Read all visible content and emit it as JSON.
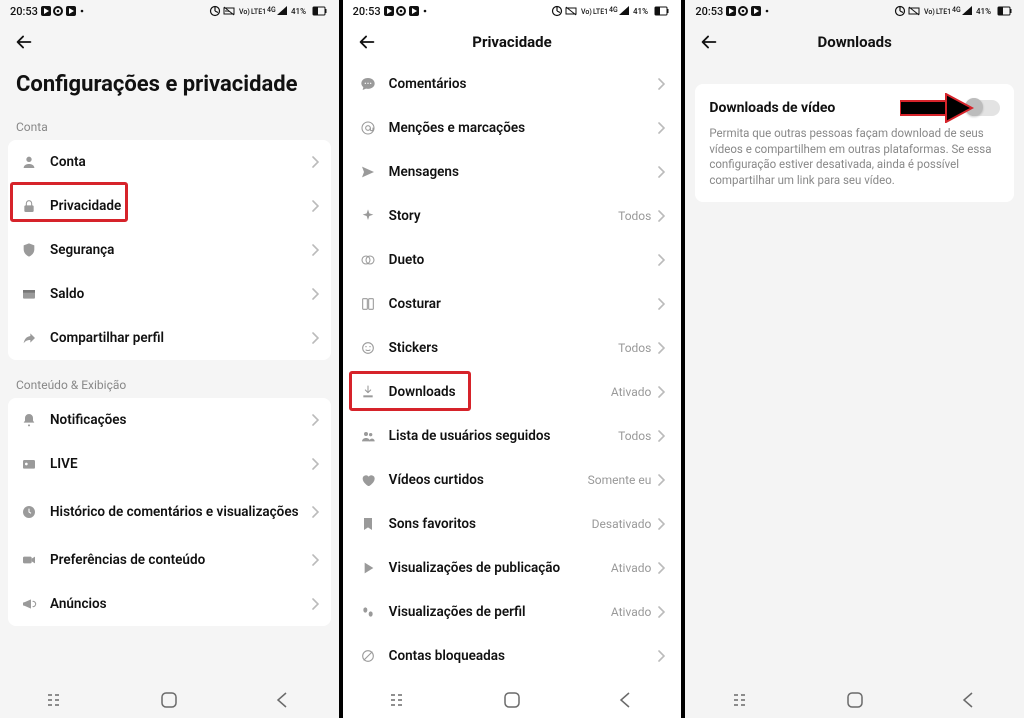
{
  "status": {
    "time": "20:53",
    "battery_text": "41%",
    "net_label": "4G"
  },
  "screen1": {
    "title": "Configurações e privacidade",
    "section_conta": "Conta",
    "section_conteudo": "Conteúdo & Exibição",
    "items_conta": [
      {
        "icon": "person",
        "label": "Conta"
      },
      {
        "icon": "lock",
        "label": "Privacidade",
        "highlight": true
      },
      {
        "icon": "shield",
        "label": "Segurança"
      },
      {
        "icon": "wallet",
        "label": "Saldo"
      },
      {
        "icon": "share",
        "label": "Compartilhar perfil"
      }
    ],
    "items_conteudo": [
      {
        "icon": "bell",
        "label": "Notificações"
      },
      {
        "icon": "live",
        "label": "LIVE"
      },
      {
        "icon": "clock",
        "label": "Histórico de comentários e visualizações"
      },
      {
        "icon": "video",
        "label": "Preferências de conteúdo"
      },
      {
        "icon": "megaphone",
        "label": "Anúncios"
      }
    ]
  },
  "screen2": {
    "title": "Privacidade",
    "items": [
      {
        "icon": "comment",
        "label": "Comentários",
        "value": ""
      },
      {
        "icon": "at",
        "label": "Menções e marcações",
        "value": ""
      },
      {
        "icon": "send",
        "label": "Mensagens",
        "value": ""
      },
      {
        "icon": "sparkle",
        "label": "Story",
        "value": "Todos"
      },
      {
        "icon": "duet",
        "label": "Dueto",
        "value": ""
      },
      {
        "icon": "stitch",
        "label": "Costurar",
        "value": ""
      },
      {
        "icon": "sticker",
        "label": "Stickers",
        "value": "Todos"
      },
      {
        "icon": "download",
        "label": "Downloads",
        "value": "Ativado",
        "highlight": true
      },
      {
        "icon": "group",
        "label": "Lista de usuários seguidos",
        "value": "Todos"
      },
      {
        "icon": "heart",
        "label": "Vídeos curtidos",
        "value": "Somente eu"
      },
      {
        "icon": "bookmark",
        "label": "Sons favoritos",
        "value": "Desativado"
      },
      {
        "icon": "play",
        "label": "Visualizações de publicação",
        "value": "Ativado"
      },
      {
        "icon": "footprints",
        "label": "Visualizações de perfil",
        "value": "Ativado"
      },
      {
        "icon": "block",
        "label": "Contas bloqueadas",
        "value": ""
      }
    ]
  },
  "screen3": {
    "title": "Downloads",
    "toggle_title": "Downloads de vídeo",
    "toggle_desc": "Permita que outras pessoas façam download de seus vídeos e compartilhem em outras plataformas. Se essa configuração estiver desativada, ainda é possível compartilhar um link para seu vídeo.",
    "toggle_on": false
  }
}
